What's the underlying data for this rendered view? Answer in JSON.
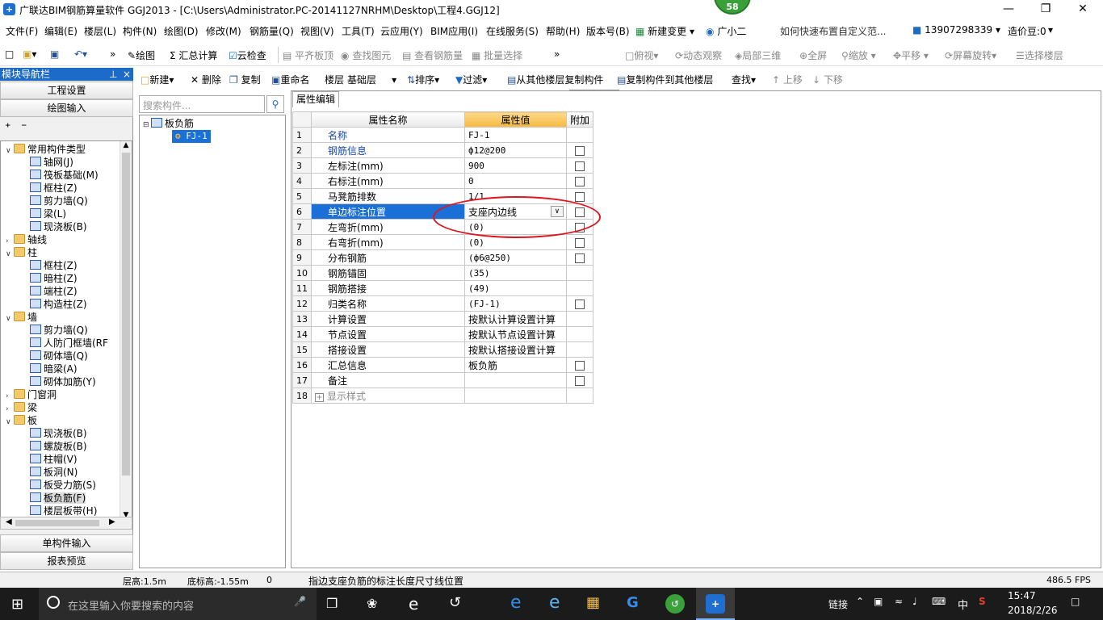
{
  "window": {
    "title": "广联达BIM钢筋算量软件 GGJ2013 - [C:\\Users\\Administrator.PC-20141127NRHM\\Desktop\\工程4.GGJ12]",
    "badge": "58",
    "app_icon": "plus-icon"
  },
  "menubar": {
    "items": [
      "文件(F)",
      "编辑(E)",
      "楼层(L)",
      "构件(N)",
      "绘图(D)",
      "修改(M)",
      "钢筋量(Q)",
      "视图(V)",
      "工具(T)",
      "云应用(Y)",
      "BIM应用(I)",
      "在线服务(S)",
      "帮助(H)",
      "版本号(B)"
    ],
    "new_change": "新建变更",
    "assistant": "广小二",
    "help_link": "如何快速布置自定义范...",
    "phone": "13907298339",
    "cost_beans": "造价豆:0"
  },
  "toolbar1": {
    "draw": "绘图",
    "sum": "汇总计算",
    "cloud_check": "云检查",
    "flat_slab": "平齐板顶",
    "find_elem": "查找图元",
    "view_rebar": "查看钢筋量",
    "batch_select": "批量选择",
    "view_mode": "二维",
    "top_view": "俯视",
    "dynamic": "动态观察",
    "local_3d": "局部三维",
    "fullscreen": "全屏",
    "zoom": "缩放",
    "pan": "平移",
    "rotate": "屏幕旋转",
    "select_floor": "选择楼层"
  },
  "toolbar2": {
    "new": "新建",
    "delete": "删除",
    "copy": "复制",
    "rename": "重命名",
    "floor_label": "楼层",
    "floor_value": "基础层",
    "sort": "排序",
    "filter": "过滤",
    "copy_from": "从其他楼层复制构件",
    "copy_to": "复制构件到其他楼层",
    "find": "查找",
    "move_up": "上移",
    "move_down": "下移"
  },
  "nav": {
    "header": "模块导航栏",
    "project_settings": "工程设置",
    "draw_input": "绘图输入",
    "single_input": "单构件输入",
    "report_preview": "报表预览",
    "tree": [
      {
        "label": "常用构件类型",
        "level": 0,
        "type": "folder",
        "open": true
      },
      {
        "label": "轴网(J)",
        "level": 1,
        "type": "comp"
      },
      {
        "label": "筏板基础(M)",
        "level": 1,
        "type": "comp"
      },
      {
        "label": "框柱(Z)",
        "level": 1,
        "type": "comp"
      },
      {
        "label": "剪力墙(Q)",
        "level": 1,
        "type": "comp"
      },
      {
        "label": "梁(L)",
        "level": 1,
        "type": "comp"
      },
      {
        "label": "现浇板(B)",
        "level": 1,
        "type": "comp"
      },
      {
        "label": "轴线",
        "level": 0,
        "type": "folder",
        "open": false
      },
      {
        "label": "柱",
        "level": 0,
        "type": "folder",
        "open": true
      },
      {
        "label": "框柱(Z)",
        "level": 1,
        "type": "comp"
      },
      {
        "label": "暗柱(Z)",
        "level": 1,
        "type": "comp"
      },
      {
        "label": "端柱(Z)",
        "level": 1,
        "type": "comp"
      },
      {
        "label": "构造柱(Z)",
        "level": 1,
        "type": "comp"
      },
      {
        "label": "墙",
        "level": 0,
        "type": "folder",
        "open": true
      },
      {
        "label": "剪力墙(Q)",
        "level": 1,
        "type": "comp"
      },
      {
        "label": "人防门框墙(RF",
        "level": 1,
        "type": "comp"
      },
      {
        "label": "砌体墙(Q)",
        "level": 1,
        "type": "comp"
      },
      {
        "label": "暗梁(A)",
        "level": 1,
        "type": "comp"
      },
      {
        "label": "砌体加筋(Y)",
        "level": 1,
        "type": "comp"
      },
      {
        "label": "门窗洞",
        "level": 0,
        "type": "folder",
        "open": false
      },
      {
        "label": "梁",
        "level": 0,
        "type": "folder",
        "open": false
      },
      {
        "label": "板",
        "level": 0,
        "type": "folder",
        "open": true
      },
      {
        "label": "现浇板(B)",
        "level": 1,
        "type": "comp"
      },
      {
        "label": "螺旋板(B)",
        "level": 1,
        "type": "comp"
      },
      {
        "label": "柱帽(V)",
        "level": 1,
        "type": "comp"
      },
      {
        "label": "板洞(N)",
        "level": 1,
        "type": "comp"
      },
      {
        "label": "板受力筋(S)",
        "level": 1,
        "type": "comp"
      },
      {
        "label": "板负筋(F)",
        "level": 1,
        "type": "comp",
        "selected": true
      },
      {
        "label": "楼层板带(H)",
        "level": 1,
        "type": "comp"
      }
    ]
  },
  "component_tree": {
    "search_placeholder": "搜索构件...",
    "root": "板负筋",
    "child": "FJ-1"
  },
  "properties": {
    "tab": "属性编辑",
    "col_name": "属性名称",
    "col_value": "属性值",
    "col_extra": "附加",
    "rows": [
      {
        "no": "1",
        "name": "名称",
        "value": "FJ-1",
        "blue": true,
        "check": false
      },
      {
        "no": "2",
        "name": "钢筋信息",
        "value": "ф12@200",
        "blue": true,
        "check": true
      },
      {
        "no": "3",
        "name": "左标注(mm)",
        "value": "900",
        "check": true
      },
      {
        "no": "4",
        "name": "右标注(mm)",
        "value": "0",
        "check": true
      },
      {
        "no": "5",
        "name": "马凳筋排数",
        "value": "1/1",
        "check": true
      },
      {
        "no": "6",
        "name": "单边标注位置",
        "value": "支座内边线",
        "check": true,
        "selected": true
      },
      {
        "no": "7",
        "name": "左弯折(mm)",
        "value": "(0)",
        "check": true
      },
      {
        "no": "8",
        "name": "右弯折(mm)",
        "value": "(0)",
        "check": true
      },
      {
        "no": "9",
        "name": "分布钢筋",
        "value": "(ф6@250)",
        "check": true
      },
      {
        "no": "10",
        "name": "钢筋锚固",
        "value": "(35)",
        "check": false
      },
      {
        "no": "11",
        "name": "钢筋搭接",
        "value": "(49)",
        "check": false
      },
      {
        "no": "12",
        "name": "归类名称",
        "value": "(FJ-1)",
        "check": true
      },
      {
        "no": "13",
        "name": "计算设置",
        "value": "按默认计算设置计算",
        "check": false
      },
      {
        "no": "14",
        "name": "节点设置",
        "value": "按默认节点设置计算",
        "check": false
      },
      {
        "no": "15",
        "name": "搭接设置",
        "value": "按默认搭接设置计算",
        "check": false
      },
      {
        "no": "16",
        "name": "汇总信息",
        "value": "板负筋",
        "check": true
      },
      {
        "no": "17",
        "name": "备注",
        "value": "",
        "check": true
      },
      {
        "no": "18",
        "name": "显示样式",
        "value": "",
        "check": false,
        "expander": true
      }
    ]
  },
  "status": {
    "floor_height": "层高:1.5m",
    "base_height": "底标高:-1.55m",
    "zero": "0",
    "hint": "指边支座负筋的标注长度尺寸线位置",
    "fps": "486.5 FPS"
  },
  "taskbar": {
    "search_placeholder": "在这里输入你要搜索的内容",
    "link": "链接",
    "ime": "中",
    "time": "15:47",
    "date": "2018/2/26"
  }
}
